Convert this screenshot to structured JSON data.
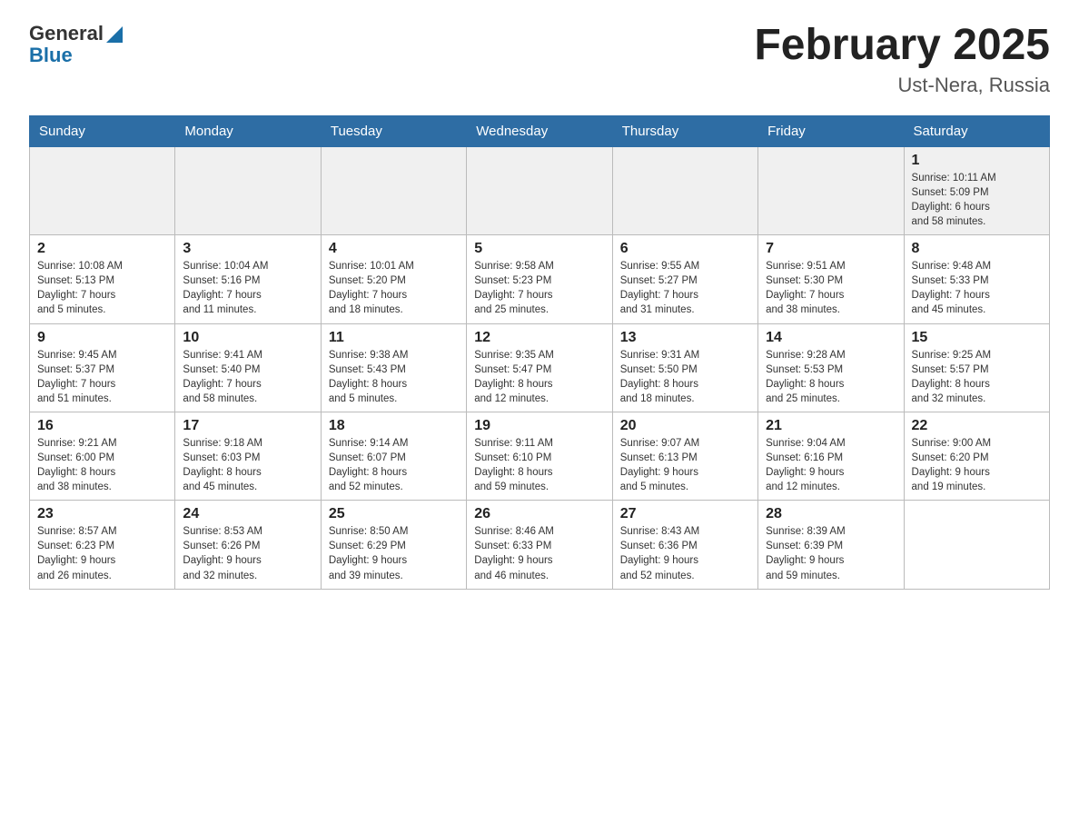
{
  "header": {
    "logo_general": "General",
    "logo_blue": "Blue",
    "title": "February 2025",
    "subtitle": "Ust-Nera, Russia"
  },
  "weekdays": [
    "Sunday",
    "Monday",
    "Tuesday",
    "Wednesday",
    "Thursday",
    "Friday",
    "Saturday"
  ],
  "weeks": [
    [
      {
        "day": "",
        "info": ""
      },
      {
        "day": "",
        "info": ""
      },
      {
        "day": "",
        "info": ""
      },
      {
        "day": "",
        "info": ""
      },
      {
        "day": "",
        "info": ""
      },
      {
        "day": "",
        "info": ""
      },
      {
        "day": "1",
        "info": "Sunrise: 10:11 AM\nSunset: 5:09 PM\nDaylight: 6 hours\nand 58 minutes."
      }
    ],
    [
      {
        "day": "2",
        "info": "Sunrise: 10:08 AM\nSunset: 5:13 PM\nDaylight: 7 hours\nand 5 minutes."
      },
      {
        "day": "3",
        "info": "Sunrise: 10:04 AM\nSunset: 5:16 PM\nDaylight: 7 hours\nand 11 minutes."
      },
      {
        "day": "4",
        "info": "Sunrise: 10:01 AM\nSunset: 5:20 PM\nDaylight: 7 hours\nand 18 minutes."
      },
      {
        "day": "5",
        "info": "Sunrise: 9:58 AM\nSunset: 5:23 PM\nDaylight: 7 hours\nand 25 minutes."
      },
      {
        "day": "6",
        "info": "Sunrise: 9:55 AM\nSunset: 5:27 PM\nDaylight: 7 hours\nand 31 minutes."
      },
      {
        "day": "7",
        "info": "Sunrise: 9:51 AM\nSunset: 5:30 PM\nDaylight: 7 hours\nand 38 minutes."
      },
      {
        "day": "8",
        "info": "Sunrise: 9:48 AM\nSunset: 5:33 PM\nDaylight: 7 hours\nand 45 minutes."
      }
    ],
    [
      {
        "day": "9",
        "info": "Sunrise: 9:45 AM\nSunset: 5:37 PM\nDaylight: 7 hours\nand 51 minutes."
      },
      {
        "day": "10",
        "info": "Sunrise: 9:41 AM\nSunset: 5:40 PM\nDaylight: 7 hours\nand 58 minutes."
      },
      {
        "day": "11",
        "info": "Sunrise: 9:38 AM\nSunset: 5:43 PM\nDaylight: 8 hours\nand 5 minutes."
      },
      {
        "day": "12",
        "info": "Sunrise: 9:35 AM\nSunset: 5:47 PM\nDaylight: 8 hours\nand 12 minutes."
      },
      {
        "day": "13",
        "info": "Sunrise: 9:31 AM\nSunset: 5:50 PM\nDaylight: 8 hours\nand 18 minutes."
      },
      {
        "day": "14",
        "info": "Sunrise: 9:28 AM\nSunset: 5:53 PM\nDaylight: 8 hours\nand 25 minutes."
      },
      {
        "day": "15",
        "info": "Sunrise: 9:25 AM\nSunset: 5:57 PM\nDaylight: 8 hours\nand 32 minutes."
      }
    ],
    [
      {
        "day": "16",
        "info": "Sunrise: 9:21 AM\nSunset: 6:00 PM\nDaylight: 8 hours\nand 38 minutes."
      },
      {
        "day": "17",
        "info": "Sunrise: 9:18 AM\nSunset: 6:03 PM\nDaylight: 8 hours\nand 45 minutes."
      },
      {
        "day": "18",
        "info": "Sunrise: 9:14 AM\nSunset: 6:07 PM\nDaylight: 8 hours\nand 52 minutes."
      },
      {
        "day": "19",
        "info": "Sunrise: 9:11 AM\nSunset: 6:10 PM\nDaylight: 8 hours\nand 59 minutes."
      },
      {
        "day": "20",
        "info": "Sunrise: 9:07 AM\nSunset: 6:13 PM\nDaylight: 9 hours\nand 5 minutes."
      },
      {
        "day": "21",
        "info": "Sunrise: 9:04 AM\nSunset: 6:16 PM\nDaylight: 9 hours\nand 12 minutes."
      },
      {
        "day": "22",
        "info": "Sunrise: 9:00 AM\nSunset: 6:20 PM\nDaylight: 9 hours\nand 19 minutes."
      }
    ],
    [
      {
        "day": "23",
        "info": "Sunrise: 8:57 AM\nSunset: 6:23 PM\nDaylight: 9 hours\nand 26 minutes."
      },
      {
        "day": "24",
        "info": "Sunrise: 8:53 AM\nSunset: 6:26 PM\nDaylight: 9 hours\nand 32 minutes."
      },
      {
        "day": "25",
        "info": "Sunrise: 8:50 AM\nSunset: 6:29 PM\nDaylight: 9 hours\nand 39 minutes."
      },
      {
        "day": "26",
        "info": "Sunrise: 8:46 AM\nSunset: 6:33 PM\nDaylight: 9 hours\nand 46 minutes."
      },
      {
        "day": "27",
        "info": "Sunrise: 8:43 AM\nSunset: 6:36 PM\nDaylight: 9 hours\nand 52 minutes."
      },
      {
        "day": "28",
        "info": "Sunrise: 8:39 AM\nSunset: 6:39 PM\nDaylight: 9 hours\nand 59 minutes."
      },
      {
        "day": "",
        "info": ""
      }
    ]
  ]
}
